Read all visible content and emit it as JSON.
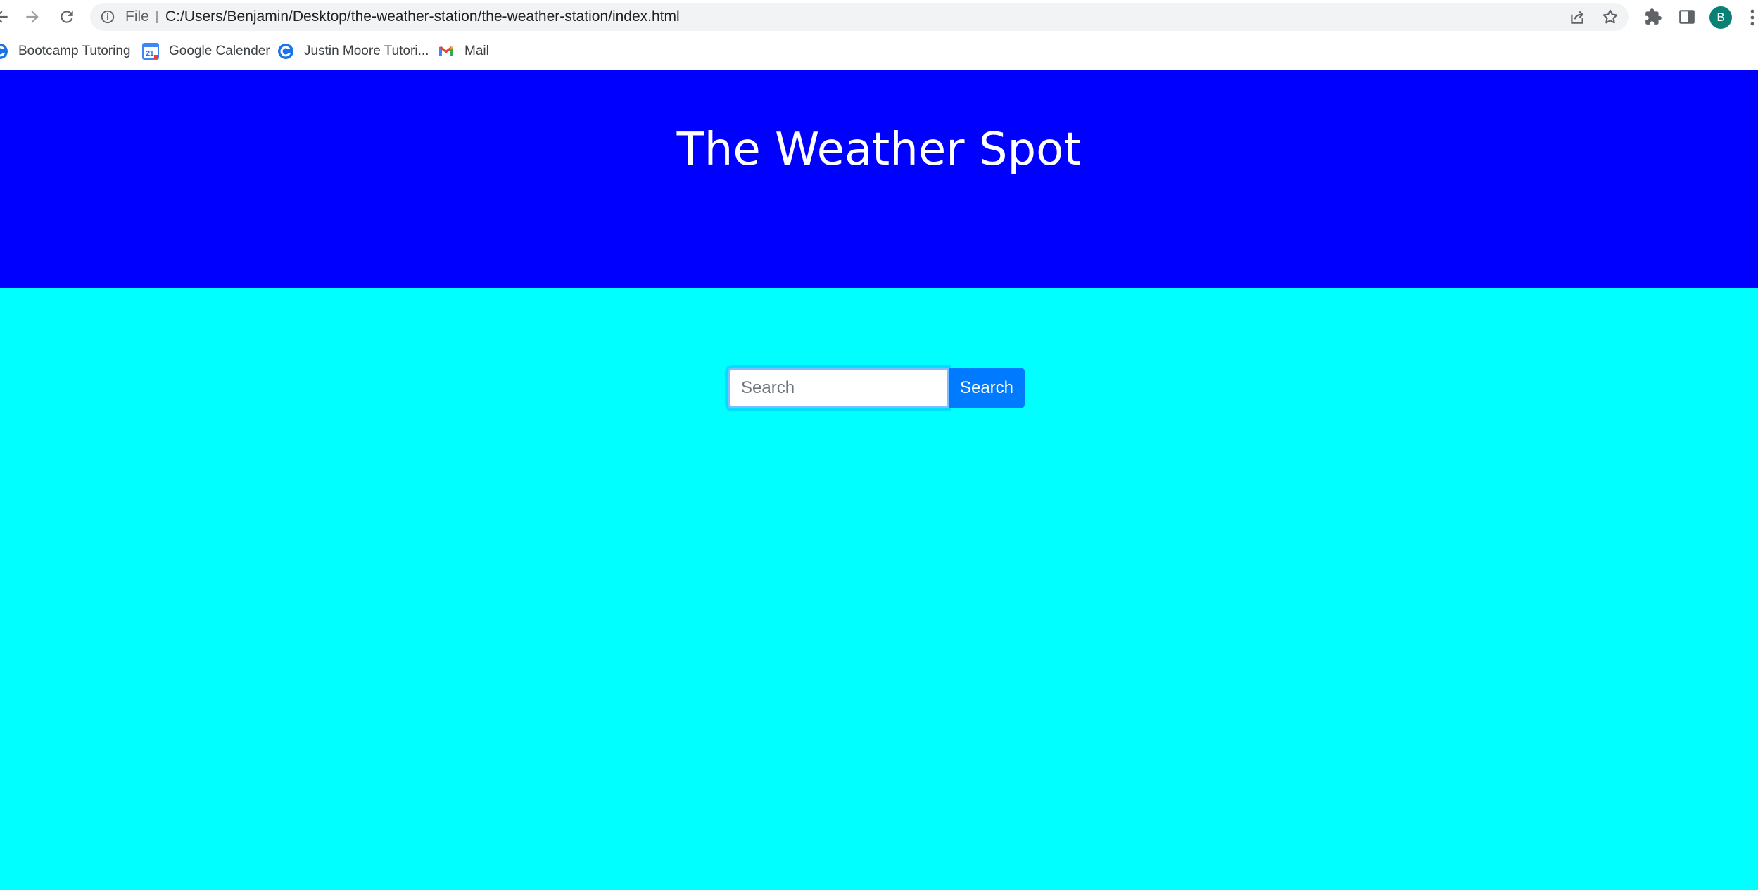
{
  "browser": {
    "omnibox": {
      "scheme_label": "File",
      "url": "C:/Users/Benjamin/Desktop/the-weather-station/the-weather-station/index.html"
    },
    "profile_initial": "B",
    "icons": {
      "back": "back-arrow-icon",
      "forward": "forward-arrow-icon",
      "reload": "reload-icon",
      "info": "info-icon",
      "share": "share-icon",
      "bookmark_star": "star-icon",
      "extensions": "puzzle-icon",
      "side_panel": "side-panel-icon",
      "menu": "kebab-menu-icon"
    }
  },
  "bookmarks": [
    {
      "label": "Bootcamp Tutoring",
      "icon": "bootcamp-icon"
    },
    {
      "label": "Google Calender",
      "icon": "calendar-icon",
      "icon_text": "21"
    },
    {
      "label": "Justin Moore Tutori...",
      "icon": "bootcamp-icon"
    },
    {
      "label": "Mail",
      "icon": "gmail-icon"
    }
  ],
  "page": {
    "title": "The Weather Spot",
    "search": {
      "placeholder": "Search",
      "value": "",
      "button_label": "Search"
    },
    "colors": {
      "header_background": "#0000ff",
      "body_background": "#00ffff",
      "button_background": "#007bff",
      "title_text": "#ffffff"
    }
  }
}
